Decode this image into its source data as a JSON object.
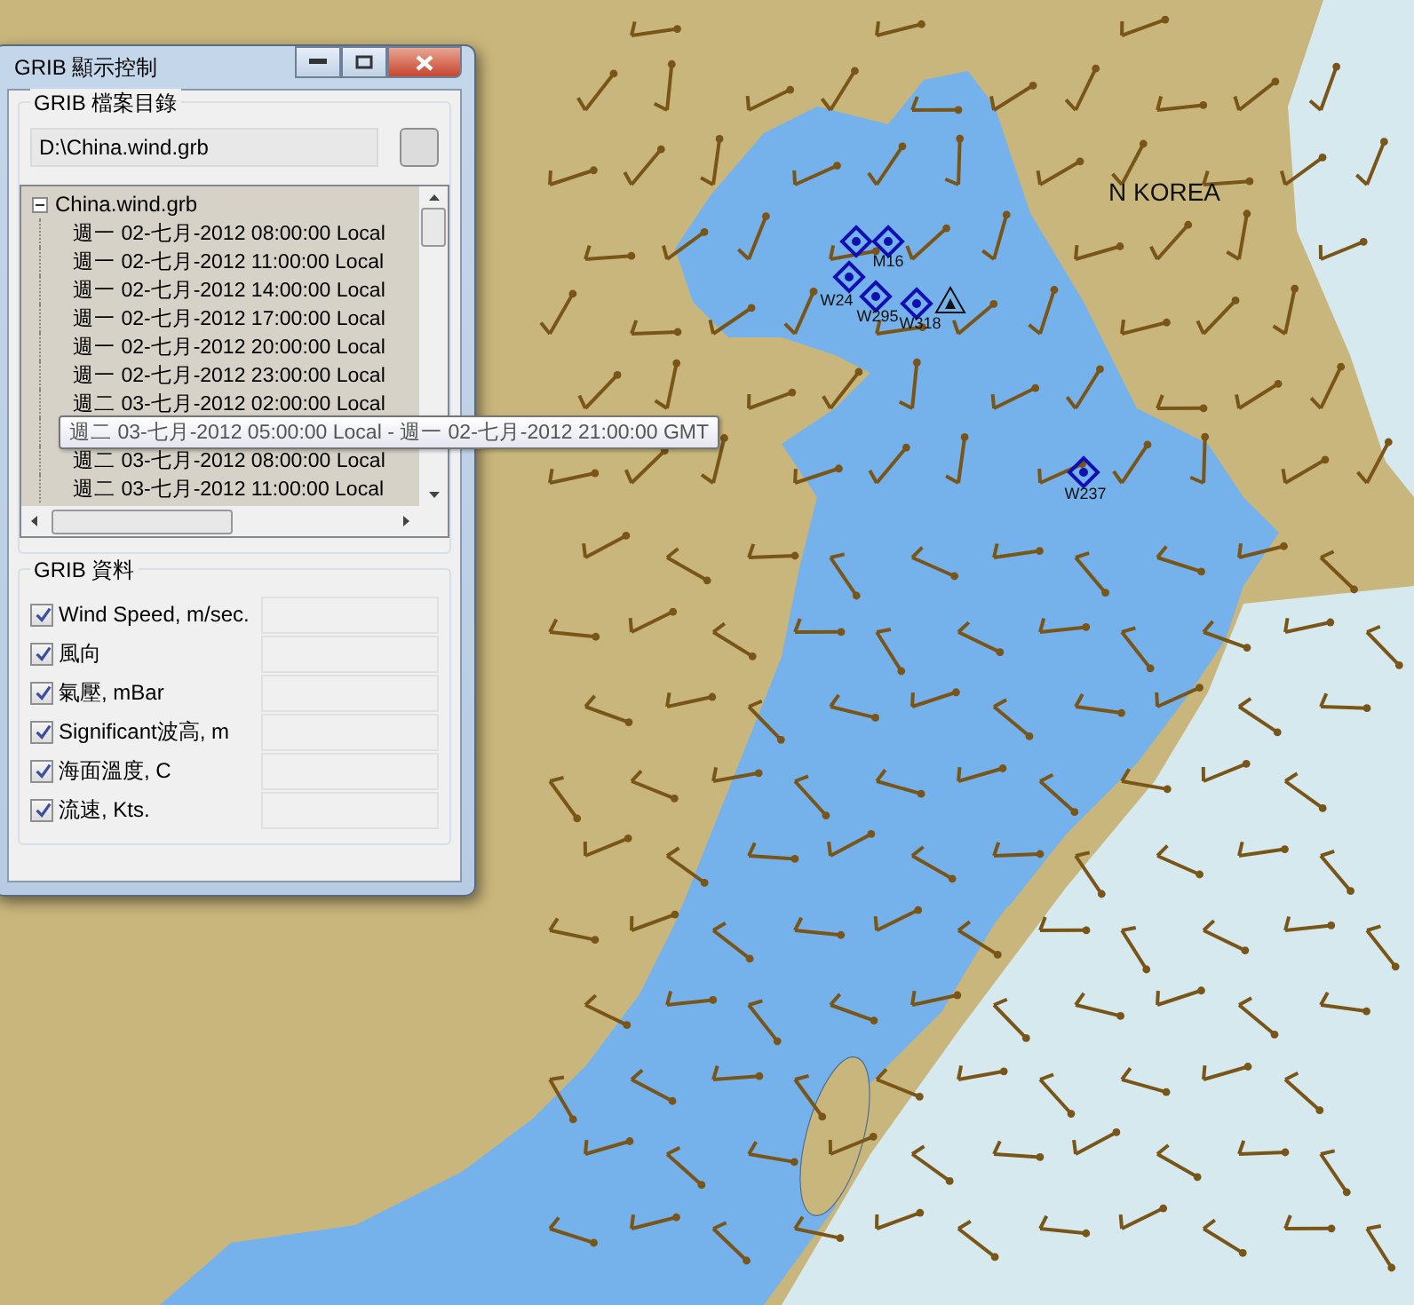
{
  "dialog": {
    "title": "GRIB 顯示控制",
    "file_group": {
      "title": "GRIB 檔案目錄",
      "path": "D:\\China.wind.grb"
    },
    "tree": {
      "root": "China.wind.grb",
      "expanded": true,
      "items": [
        {
          "kind": "entry",
          "text": "週一 02-七月-2012 08:00:00 Local"
        },
        {
          "kind": "entry",
          "text": "週一 02-七月-2012 11:00:00 Local"
        },
        {
          "kind": "entry",
          "text": "週一 02-七月-2012 14:00:00 Local"
        },
        {
          "kind": "entry",
          "text": "週一 02-七月-2012 17:00:00 Local"
        },
        {
          "kind": "entry",
          "text": "週一 02-七月-2012 20:00:00 Local"
        },
        {
          "kind": "entry",
          "text": "週一 02-七月-2012 23:00:00 Local"
        },
        {
          "kind": "entry",
          "text": "週二 03-七月-2012 02:00:00 Local"
        },
        {
          "kind": "tooltip",
          "text": "週二 03-七月-2012 05:00:00 Local - 週一 02-七月-2012 21:00:00 GMT"
        },
        {
          "kind": "entry",
          "text": "週二 03-七月-2012 08:00:00 Local"
        },
        {
          "kind": "entry",
          "text": "週二 03-七月-2012 11:00:00 Local"
        }
      ]
    },
    "data_group": {
      "title": "GRIB 資料",
      "rows": [
        {
          "label": "Wind Speed, m/sec.",
          "checked": true
        },
        {
          "label": "風向",
          "checked": true
        },
        {
          "label": "氣壓, mBar",
          "checked": true
        },
        {
          "label": "Significant波高, m",
          "checked": true
        },
        {
          "label": "海面溫度, C",
          "checked": true
        },
        {
          "label": "流速, Kts.",
          "checked": true
        }
      ]
    }
  },
  "map": {
    "region_label": "N KOREA",
    "waypoints": [
      {
        "label": "M16",
        "kind": "diamond"
      },
      {
        "label": "W24",
        "kind": "diamond"
      },
      {
        "label": "W295",
        "kind": "diamond"
      },
      {
        "label": "W318",
        "kind": "diamond"
      },
      {
        "label": "W237",
        "kind": "diamond"
      }
    ]
  }
}
